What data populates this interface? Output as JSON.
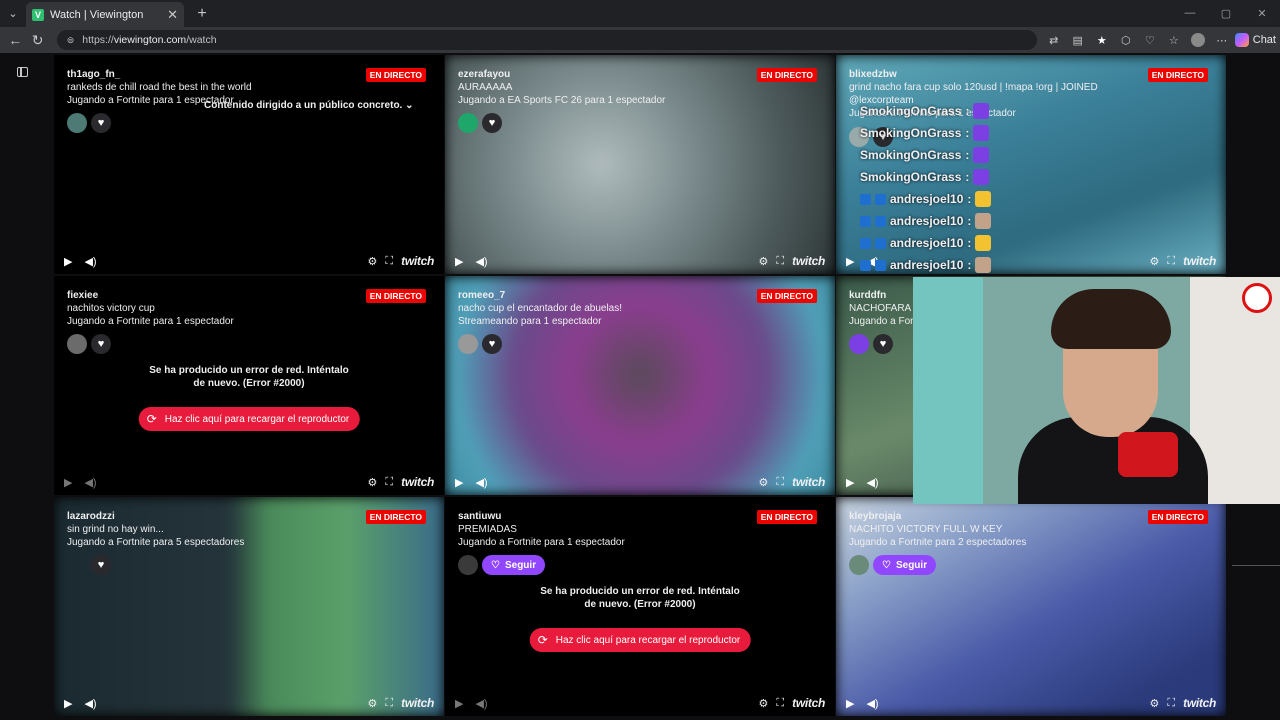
{
  "browser": {
    "tab_title": "Watch | Viewington",
    "favicon_letter": "V",
    "url_scheme": "https://",
    "url_host": "viewington.com",
    "url_path": "/watch",
    "chat_label": "Chat"
  },
  "streams": [
    {
      "user": "th1ago_fn_",
      "title": "rankeds de chill road the best in the world",
      "game": "Jugando a Fortnite para 1 espectador",
      "live": "EN DIRECTO",
      "overlay": "Contenido dirigido a un público concreto."
    },
    {
      "user": "ezerafayou",
      "title": "AURAAAAA",
      "game": "Jugando a EA Sports FC 26 para 1 espectador",
      "live": "EN DIRECTO"
    },
    {
      "user": "blixedzbw",
      "title": "grind nacho fara cup solo 120usd | !mapa !org | JOINED @lexcorpteam",
      "game": "Jugando a Fortnite para 1 espectador",
      "live": "EN DIRECTO"
    },
    {
      "user": "fiexiee",
      "title": "nachitos victory cup",
      "game": "Jugando a Fortnite para 1 espectador",
      "live": "EN DIRECTO",
      "error": "Se ha producido un error de red. Inténtalo de nuevo. (Error #2000)",
      "reload": "Haz clic aquí para recargar el reproductor"
    },
    {
      "user": "romeeo_7",
      "title": "nacho cup el encantador de abuelas!",
      "game": "Streameando para 1 espectador",
      "live": "EN DIRECTO"
    },
    {
      "user": "kurddfn",
      "title": "NACHOFARA E",
      "game": "Jugando a For",
      "live": ""
    },
    {
      "user": "lazarodzzi",
      "title": "sin grind no hay win...",
      "game": "Jugando a Fortnite para 5 espectadores",
      "live": "EN DIRECTO"
    },
    {
      "user": "santiuwu",
      "title": "PREMIADAS",
      "game": "Jugando a Fortnite para 1 espectador",
      "live": "EN DIRECTO",
      "follow": "Seguir",
      "error": "Se ha producido un error de red. Inténtalo de nuevo. (Error #2000)",
      "reload": "Haz clic aquí para recargar el reproductor"
    },
    {
      "user": "kleybrojaja",
      "title": "NACHITO VICTORY FULL W KEY",
      "game": "Jugando a Fortnite para 2 espectadores",
      "live": "EN DIRECTO",
      "follow": "Seguir"
    }
  ],
  "chat_overlay": [
    {
      "name": "SmokingOnGrass",
      "sep": ":",
      "badges": false,
      "emote_color": "#7b3fe4"
    },
    {
      "name": "SmokingOnGrass",
      "sep": ":",
      "badges": false,
      "emote_color": "#7b3fe4"
    },
    {
      "name": "SmokingOnGrass",
      "sep": ":",
      "badges": false,
      "emote_color": "#7b3fe4"
    },
    {
      "name": "SmokingOnGrass",
      "sep": ":",
      "badges": false,
      "emote_color": "#7b3fe4"
    },
    {
      "name": "andresjoel10",
      "sep": ":",
      "badges": true,
      "emote_color": "#f2c230"
    },
    {
      "name": "andresjoel10",
      "sep": ":",
      "badges": true,
      "emote_color": "#c2a288"
    },
    {
      "name": "andresjoel10",
      "sep": ":",
      "badges": true,
      "emote_color": "#f2c230"
    },
    {
      "name": "andresjoel10",
      "sep": ":",
      "badges": true,
      "emote_color": "#c2a288"
    }
  ],
  "player": {
    "brand": "twitch"
  },
  "colors": {
    "live": "#eb0400",
    "follow": "#9147ff",
    "reload": "#e91b3c"
  }
}
